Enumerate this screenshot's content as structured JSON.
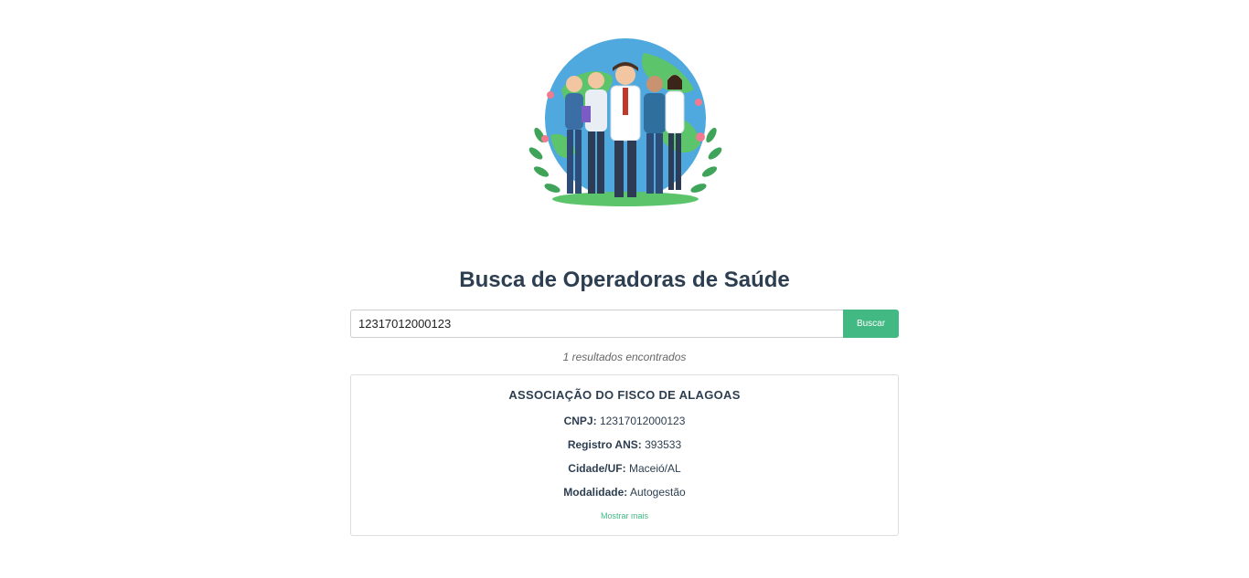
{
  "header": {
    "title": "Busca de Operadoras de Saúde"
  },
  "search": {
    "value": "12317012000123",
    "button_label": "Buscar"
  },
  "results": {
    "count_text": "1 resultados encontrados",
    "items": [
      {
        "name": "ASSOCIAÇÃO DO FISCO DE ALAGOAS",
        "cnpj_label": "CNPJ:",
        "cnpj": "12317012000123",
        "registro_label": "Registro ANS:",
        "registro": "393533",
        "cidade_label": "Cidade/UF:",
        "cidade": "Maceió/AL",
        "modalidade_label": "Modalidade:",
        "modalidade": "Autogestão",
        "show_more_label": "Mostrar mais"
      }
    ]
  },
  "colors": {
    "accent": "#42b883",
    "title": "#2c3e50",
    "muted": "#666666"
  }
}
